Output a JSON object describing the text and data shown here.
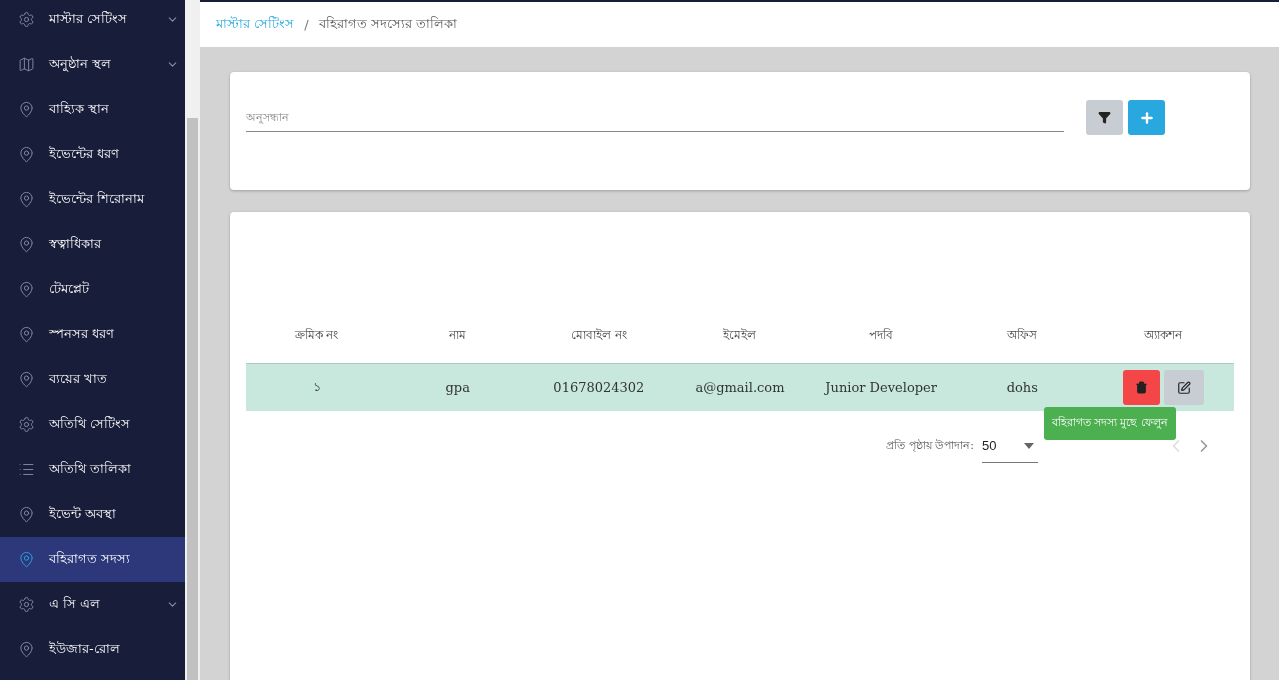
{
  "sidebar": {
    "items": [
      {
        "label": "মাস্টার সেটিংস",
        "kind": "gear",
        "has_submenu": true,
        "selected": false
      },
      {
        "label": "অনুষ্ঠান স্থল",
        "kind": "map",
        "has_submenu": true,
        "selected": false
      },
      {
        "label": "বাহ্যিক স্থান",
        "kind": "pin",
        "has_submenu": false,
        "selected": false
      },
      {
        "label": "ইভেন্টের ধরণ",
        "kind": "pin",
        "has_submenu": false,
        "selected": false
      },
      {
        "label": "ইভেন্টের শিরোনাম",
        "kind": "pin",
        "has_submenu": false,
        "selected": false
      },
      {
        "label": "স্বত্বাধিকার",
        "kind": "pin",
        "has_submenu": false,
        "selected": false
      },
      {
        "label": "টেমপ্লেট",
        "kind": "pin",
        "has_submenu": false,
        "selected": false
      },
      {
        "label": "স্পনসর ধরণ",
        "kind": "pin",
        "has_submenu": false,
        "selected": false
      },
      {
        "label": "ব্যয়ের খাত",
        "kind": "pin",
        "has_submenu": false,
        "selected": false
      },
      {
        "label": "অতিথি সেটিংস",
        "kind": "gear",
        "has_submenu": false,
        "selected": false
      },
      {
        "label": "অতিথি তালিকা",
        "kind": "list",
        "has_submenu": false,
        "selected": false
      },
      {
        "label": "ইভেন্ট অবস্থা",
        "kind": "pin",
        "has_submenu": false,
        "selected": false
      },
      {
        "label": "বহিরাগত সদস্য",
        "kind": "pin",
        "has_submenu": false,
        "selected": true
      },
      {
        "label": "এ সি এল",
        "kind": "gear",
        "has_submenu": true,
        "selected": false
      },
      {
        "label": "ইউজার-রোল",
        "kind": "pin",
        "has_submenu": false,
        "selected": false
      }
    ]
  },
  "breadcrumb": {
    "parent": "মাস্টার সেটিংস",
    "separator": "/",
    "current": "বহিরাগত সদস্যের তালিকা"
  },
  "search": {
    "placeholder": "অনুসন্ধান"
  },
  "table": {
    "columns": [
      "ক্রমিক নং",
      "নাম",
      "মোবাইল নং",
      "ইমেইল",
      "পদবি",
      "অফিস",
      "অ্যাকশন"
    ],
    "rows": [
      {
        "highlighted": true,
        "cells": [
          "১",
          "gpa",
          "01678024302",
          "a@gmail.com",
          "Junior Developer",
          "dohs"
        ]
      }
    ]
  },
  "tooltip": {
    "text": "বহিরাগত সদস্য মুছে ফেলুন"
  },
  "pagination": {
    "per_page_label": "প্রতি পৃষ্ঠায় উপাদান:",
    "per_page_value": "50",
    "prev_disabled": true,
    "next_disabled": false
  }
}
